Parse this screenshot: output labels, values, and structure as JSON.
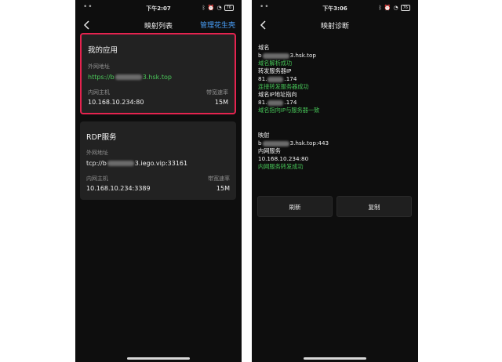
{
  "left": {
    "status": {
      "time": "下午2:07",
      "battery": "76"
    },
    "nav": {
      "title": "映射列表",
      "action": "管理花生壳"
    },
    "cards": [
      {
        "title": "我的应用",
        "ext_label": "外网地址",
        "ext_prefix": "https://b",
        "ext_suffix": "3.hsk.top",
        "int_label": "内网主机",
        "int_value": "10.168.10.234:80",
        "bw_label": "带宽速率",
        "bw_value": "15M"
      },
      {
        "title": "RDP服务",
        "ext_label": "外网地址",
        "ext_prefix": "tcp://b",
        "ext_suffix": "3.iego.vip:33161",
        "int_label": "内网主机",
        "int_value": "10.168.10.234:3389",
        "bw_label": "带宽速率",
        "bw_value": "15M"
      }
    ]
  },
  "right": {
    "status": {
      "time": "下午3:06",
      "battery": "76"
    },
    "nav": {
      "title": "映射诊断"
    },
    "diag": {
      "domain_label": "域名",
      "domain_prefix": "b",
      "domain_suffix": "3.hsk.top",
      "domain_ok": "域名解析成功",
      "relay_label": "转发服务器IP",
      "relay_prefix": "81.",
      "relay_suffix": ".174",
      "relay_ok": "连接转发服务器成功",
      "point_label": "域名IP地址指向",
      "point_prefix": "81.",
      "point_suffix": ".174",
      "point_ok": "域名指向IP与服务器一致",
      "map_label": "映射",
      "map_prefix": "b",
      "map_suffix": "3.hsk.top:443",
      "inner_label": "内网服务",
      "inner_value": "10.168.10.234:80",
      "inner_ok": "内网服务转发成功"
    },
    "buttons": {
      "refresh": "刷新",
      "copy": "复制"
    }
  }
}
